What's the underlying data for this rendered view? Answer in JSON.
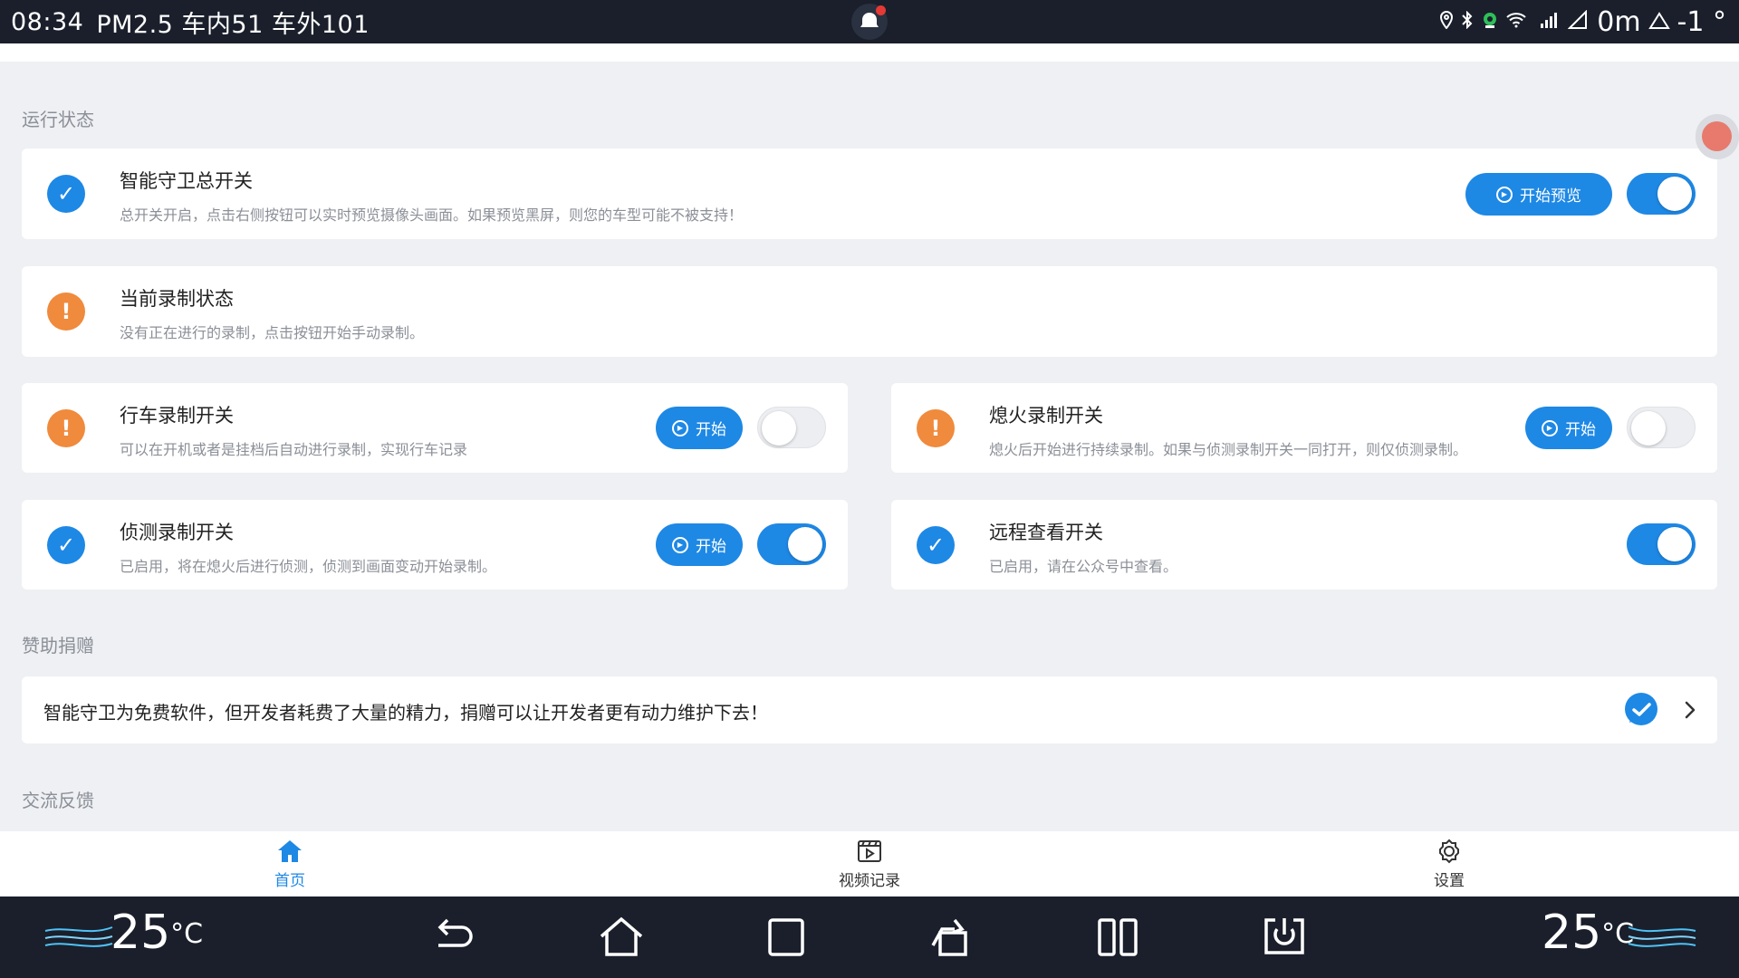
{
  "status": {
    "time": "08:34",
    "pm25": "PM2.5 车内51 车外101",
    "altitude": "0m",
    "temperature": "-1 °"
  },
  "sections": {
    "running": "运行状态",
    "donate": "赞助捐赠",
    "feedback": "交流反馈"
  },
  "main_switch": {
    "title": "智能守卫总开关",
    "desc": "总开关开启，点击右侧按钮可以实时预览摄像头画面。如果预览黑屏，则您的车型可能不被支持！",
    "button": "开始预览",
    "on": true
  },
  "record_status": {
    "title": "当前录制状态",
    "desc": "没有正在进行的录制，点击按钮开始手动录制。"
  },
  "drive_record": {
    "title": "行车录制开关",
    "desc": "可以在开机或者是挂档后自动进行录制，实现行车记录",
    "button": "开始",
    "on": false
  },
  "parked_record": {
    "title": "熄火录制开关",
    "desc": "熄火后开始进行持续录制。如果与侦测录制开关一同打开，则仅侦测录制。",
    "button": "开始",
    "on": false
  },
  "detect_record": {
    "title": "侦测录制开关",
    "desc": "已启用，将在熄火后进行侦测，侦测到画面变动开始录制。",
    "button": "开始",
    "on": true
  },
  "remote_view": {
    "title": "远程查看开关",
    "desc": "已启用，请在公众号中查看。",
    "on": true
  },
  "donate": {
    "text": "智能守卫为免费软件，但开发者耗费了大量的精力，捐赠可以让开发者更有动力维护下去！"
  },
  "nav": {
    "home": "首页",
    "videos": "视频记录",
    "settings": "设置"
  },
  "system": {
    "temp_left": "25",
    "temp_right": "25",
    "unit": "°C"
  },
  "colors": {
    "accent": "#1e88e5",
    "warning": "#f08a3c",
    "bar": "#1a1f2b"
  }
}
